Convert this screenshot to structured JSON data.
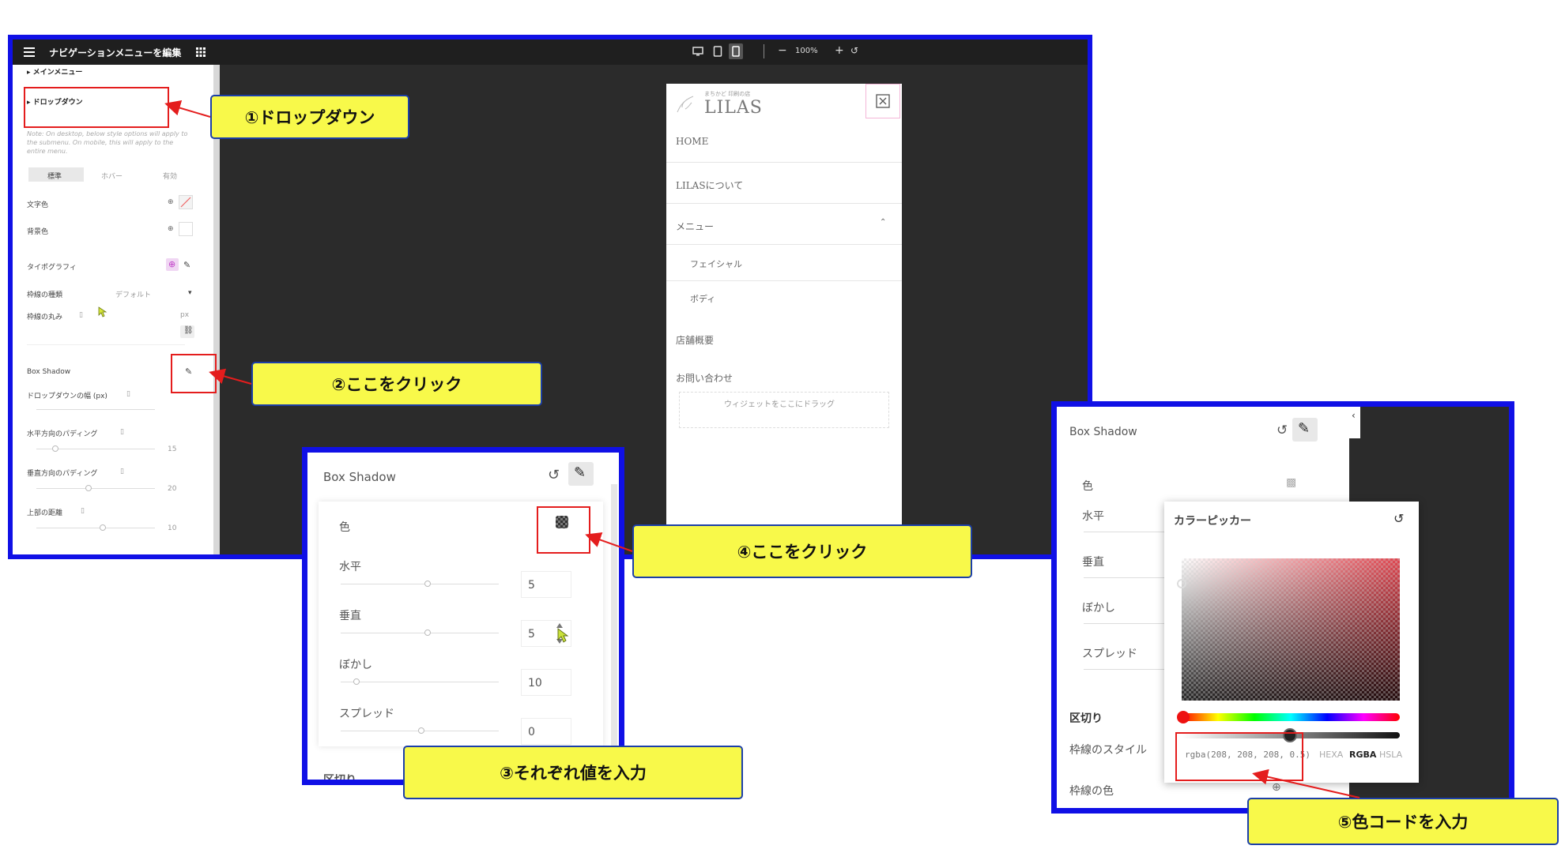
{
  "editor": {
    "title": "ナビゲーションメニューを編集",
    "zoom": "100%",
    "sections": {
      "main_menu": "メインメニュー",
      "dropdown": "ドロップダウン"
    },
    "note": "Note: On desktop, below style options will apply to the submenu. On mobile, this will apply to the entire menu.",
    "state_tabs": [
      "標準",
      "ホバー",
      "有効"
    ],
    "controls": {
      "text_color": "文字色",
      "bg_color": "背景色",
      "typography": "タイポグラフィ",
      "border_type": "枠線の種類",
      "border_type_value": "デフォルト",
      "border_radius": "枠線の丸み",
      "unit": "px",
      "box_shadow": "Box Shadow",
      "dropdown_width": "ドロップダウンの幅 (px)",
      "h_padding": "水平方向のパディング",
      "h_padding_value": "15",
      "v_padding": "垂直方向のパディング",
      "v_padding_value": "20",
      "top_distance": "上部の距離",
      "top_distance_value": "10"
    }
  },
  "preview": {
    "logo_small": "まちかど 印刷の店",
    "logo": "LILAS",
    "menu": [
      {
        "label": "HOME"
      },
      {
        "label": "LILASについて"
      },
      {
        "label": "メニュー"
      },
      {
        "label": "フェイシャル",
        "sub": true
      },
      {
        "label": "ボディ",
        "sub": true
      },
      {
        "label": "店舗概要"
      },
      {
        "label": "お問い合わせ"
      }
    ],
    "drop_hint": "ウィジェットをここにドラッグ"
  },
  "box_shadow_panel": {
    "title": "Box Shadow",
    "color_label": "色",
    "fields": [
      {
        "label": "水平",
        "value": "5"
      },
      {
        "label": "垂直",
        "value": "5"
      },
      {
        "label": "ぼかし",
        "value": "10"
      },
      {
        "label": "スプレッド",
        "value": "0"
      }
    ],
    "next_section": "区切り"
  },
  "color_picker_panel": {
    "title": "Box Shadow",
    "color_label": "色",
    "fields": [
      "水平",
      "垂直",
      "ぼかし",
      "スプレッド"
    ],
    "section": "区切り",
    "border_style": "枠線のスタイル",
    "border_color": "枠線の色",
    "picker_title": "カラーピッカー",
    "color_value": "rgba(208, 208, 208, 0.5)",
    "modes": [
      "HEXA",
      "RGBA",
      "HSLA"
    ],
    "active_mode": "RGBA"
  },
  "callouts": {
    "c1": "①ドロップダウン",
    "c2": "②ここをクリック",
    "c3": "③それぞれ値を入力",
    "c4": "④ここをクリック",
    "c5": "⑤色コードを入力"
  },
  "colors": {
    "frame_blue": "#1010e6",
    "callout_yellow": "#f8f94a",
    "annotation_red": "#e41d1d",
    "editor_dark": "#2b2b2b"
  }
}
